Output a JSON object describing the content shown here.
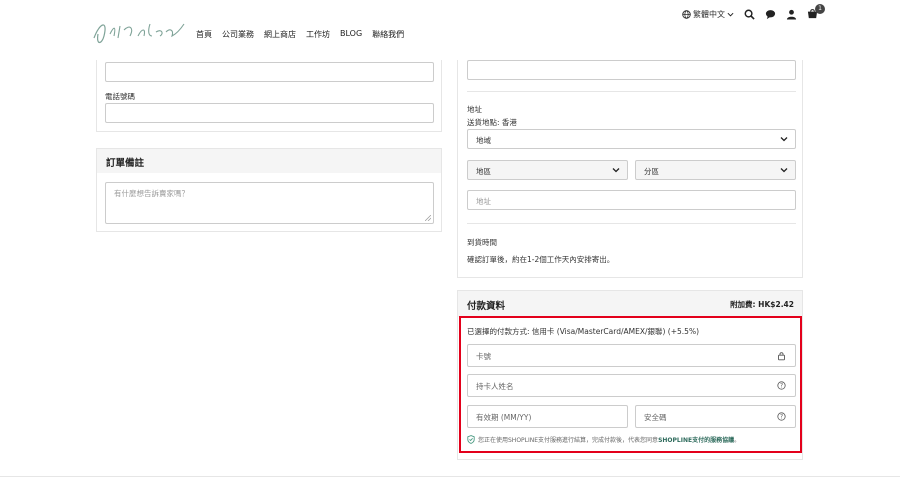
{
  "header": {
    "logo_text": "gift idea",
    "nav": [
      "首頁",
      "公司業務",
      "網上商店",
      "工作坊",
      "BLOG",
      "聯絡我們"
    ],
    "language": "繁體中文",
    "cart_count": "1"
  },
  "left": {
    "phone_label": "電話號碼",
    "notes": {
      "title": "訂單備註",
      "placeholder": "有什麼想告訴賣家嗎？"
    }
  },
  "right": {
    "address_label": "地址",
    "ship_to": "送貨地點: 香港",
    "region_select": "地域",
    "district_select": "地區",
    "subdistrict_select": "分區",
    "address_placeholder": "地址",
    "delivery_title": "到貨時間",
    "delivery_text": "確認訂單後，約在1-2個工作天內安排寄出。"
  },
  "payment": {
    "title": "付款資料",
    "surcharge": "附加費: HK$2.42",
    "method": "已選擇的付款方式: 信用卡 (Visa/MasterCard/AMEX/銀聯) (+5.5%)",
    "card_number": "卡號",
    "cardholder": "持卡人姓名",
    "expiry": "有效期 (MM/YY)",
    "cvc": "安全碼",
    "notice_prefix": "您正在使用SHOPLINE支付服務進行結算，完成付款後，代表您同意",
    "notice_link": "SHOPLINE支付的服務協議",
    "notice_suffix": "。"
  },
  "colors": {
    "highlight": "#e3001b",
    "logo": "#7fa398",
    "link": "#2e6b5c"
  }
}
